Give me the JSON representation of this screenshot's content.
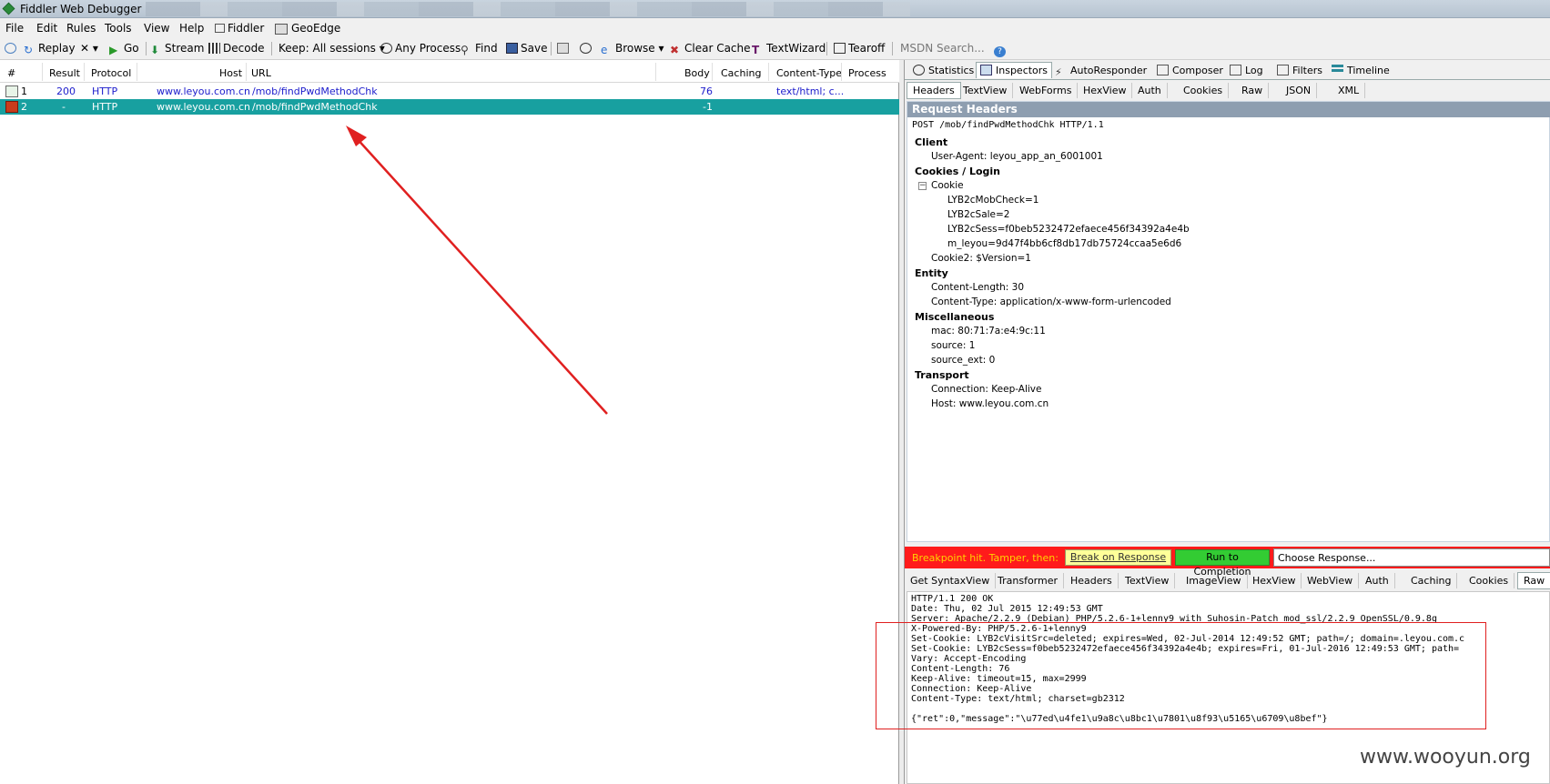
{
  "window": {
    "title": "Fiddler Web Debugger"
  },
  "menu": [
    "File",
    "Edit",
    "Rules",
    "Tools",
    "View",
    "Help",
    "Fiddler",
    "GeoEdge"
  ],
  "toolbar": {
    "replay": "Replay",
    "remove": "✕",
    "go": "Go",
    "stream": "Stream",
    "decode": "Decode",
    "keep": "Keep: All sessions",
    "any_process": "Any Process",
    "find": "Find",
    "save": "Save",
    "browse": "Browse",
    "clear_cache": "Clear Cache",
    "textwizard": "TextWizard",
    "tearoff": "Tearoff",
    "msdn_search": "MSDN Search..."
  },
  "sessions": {
    "columns": [
      "#",
      "Result",
      "Protocol",
      "Host",
      "URL",
      "Body",
      "Caching",
      "Content-Type",
      "Process"
    ],
    "rows": [
      {
        "num": "1",
        "result": "200",
        "protocol": "HTTP",
        "host": "www.leyou.com.cn",
        "url": "/mob/findPwdMethodChk",
        "body": "76",
        "caching": "",
        "content_type": "text/html; c...",
        "process": ""
      },
      {
        "num": "2",
        "result": "-",
        "protocol": "HTTP",
        "host": "www.leyou.com.cn",
        "url": "/mob/findPwdMethodChk",
        "body": "-1",
        "caching": "",
        "content_type": "",
        "process": ""
      }
    ]
  },
  "main_tabs": [
    "Statistics",
    "Inspectors",
    "AutoResponder",
    "Composer",
    "Log",
    "Filters",
    "Timeline"
  ],
  "request_tabs": [
    "Headers",
    "TextView",
    "WebForms",
    "HexView",
    "Auth",
    "Cookies",
    "Raw",
    "JSON",
    "XML"
  ],
  "request": {
    "title": "Request Headers",
    "line": "POST /mob/findPwdMethodChk HTTP/1.1",
    "groups": {
      "client": "Client",
      "user_agent": "User-Agent: leyou_app_an_6001001",
      "cookies_login": "Cookies / Login",
      "cookie": "Cookie",
      "c1": "LYB2cMobCheck=1",
      "c2": "LYB2cSale=2",
      "c3": "LYB2cSess=f0beb5232472efaece456f34392a4e4b",
      "c4": "m_leyou=9d47f4bb6cf8db17db75724ccaa5e6d6",
      "cookie2": "Cookie2: $Version=1",
      "entity": "Entity",
      "content_length": "Content-Length: 30",
      "content_type": "Content-Type: application/x-www-form-urlencoded",
      "misc": "Miscellaneous",
      "mac": "mac: 80:71:7a:e4:9c:11",
      "source": "source: 1",
      "source_ext": "source_ext: 0",
      "transport": "Transport",
      "connection": "Connection: Keep-Alive",
      "host": "Host: www.leyou.com.cn"
    }
  },
  "breakpoint": {
    "text": "Breakpoint hit. Tamper, then:",
    "break_btn": "Break on Response",
    "run_btn": "Run to Completion",
    "choose": "Choose Response..."
  },
  "response_tabs": [
    "Get SyntaxView",
    "Transformer",
    "Headers",
    "TextView",
    "ImageView",
    "HexView",
    "WebView",
    "Auth",
    "Caching",
    "Cookies",
    "Raw"
  ],
  "response_raw": "HTTP/1.1 200 OK\nDate: Thu, 02 Jul 2015 12:49:53 GMT\nServer: Apache/2.2.9 (Debian) PHP/5.2.6-1+lenny9 with Suhosin-Patch mod_ssl/2.2.9 OpenSSL/0.9.8g\nX-Powered-By: PHP/5.2.6-1+lenny9\nSet-Cookie: LYB2cVisitSrc=deleted; expires=Wed, 02-Jul-2014 12:49:52 GMT; path=/; domain=.leyou.com.c\nSet-Cookie: LYB2cSess=f0beb5232472efaece456f34392a4e4b; expires=Fri, 01-Jul-2016 12:49:53 GMT; path=\nVary: Accept-Encoding\nContent-Length: 76\nKeep-Alive: timeout=15, max=2999\nConnection: Keep-Alive\nContent-Type: text/html; charset=gb2312\n\n{\"ret\":0,\"message\":\"\\u77ed\\u4fe1\\u9a8c\\u8bc1\\u7801\\u8f93\\u5165\\u6709\\u8bef\"}",
  "watermark": "www.wooyun.org",
  "colors": {
    "selected_row": "#18a0a0",
    "breakpoint_bar": "#ff1b1b",
    "link_text": "#1c1ccc",
    "annotation": "#e02020"
  }
}
